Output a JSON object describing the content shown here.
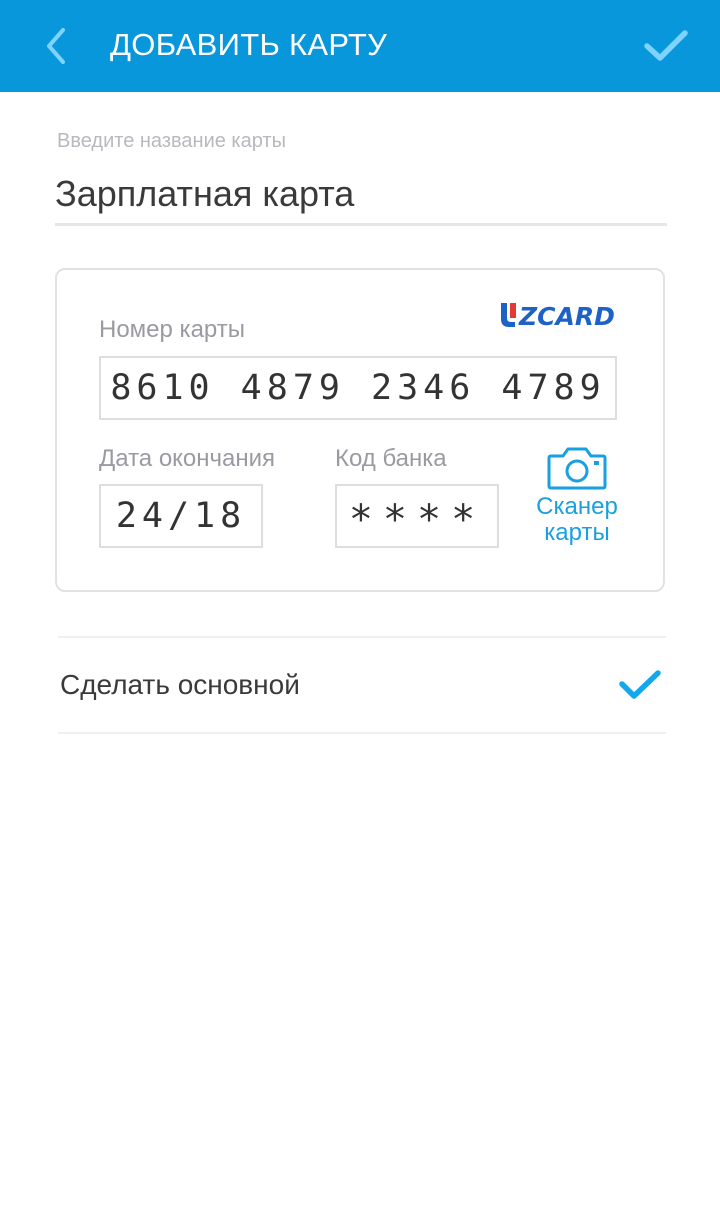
{
  "header": {
    "title": "ДОБАВИТЬ КАРТУ",
    "back_icon": "chevron-left-icon",
    "confirm_icon": "check-icon"
  },
  "card_name": {
    "label": "Введите название карты",
    "value": "Зарплатная карта"
  },
  "card": {
    "brand": "UZCARD",
    "number_label": "Номер карты",
    "number": "8610 4879 2346 4789",
    "expiry_label": "Дата окончания",
    "expiry": "24/18",
    "bank_code_label": "Код банка",
    "bank_code": "****",
    "scan_label_line1": "Сканер",
    "scan_label_line2": "карты",
    "scan_icon": "camera-icon"
  },
  "default_option": {
    "label": "Сделать основной",
    "checked": true,
    "check_icon": "check-icon"
  },
  "colors": {
    "header": "#0997dc",
    "accent": "#1aa0e0",
    "check": "#12a8ee"
  }
}
